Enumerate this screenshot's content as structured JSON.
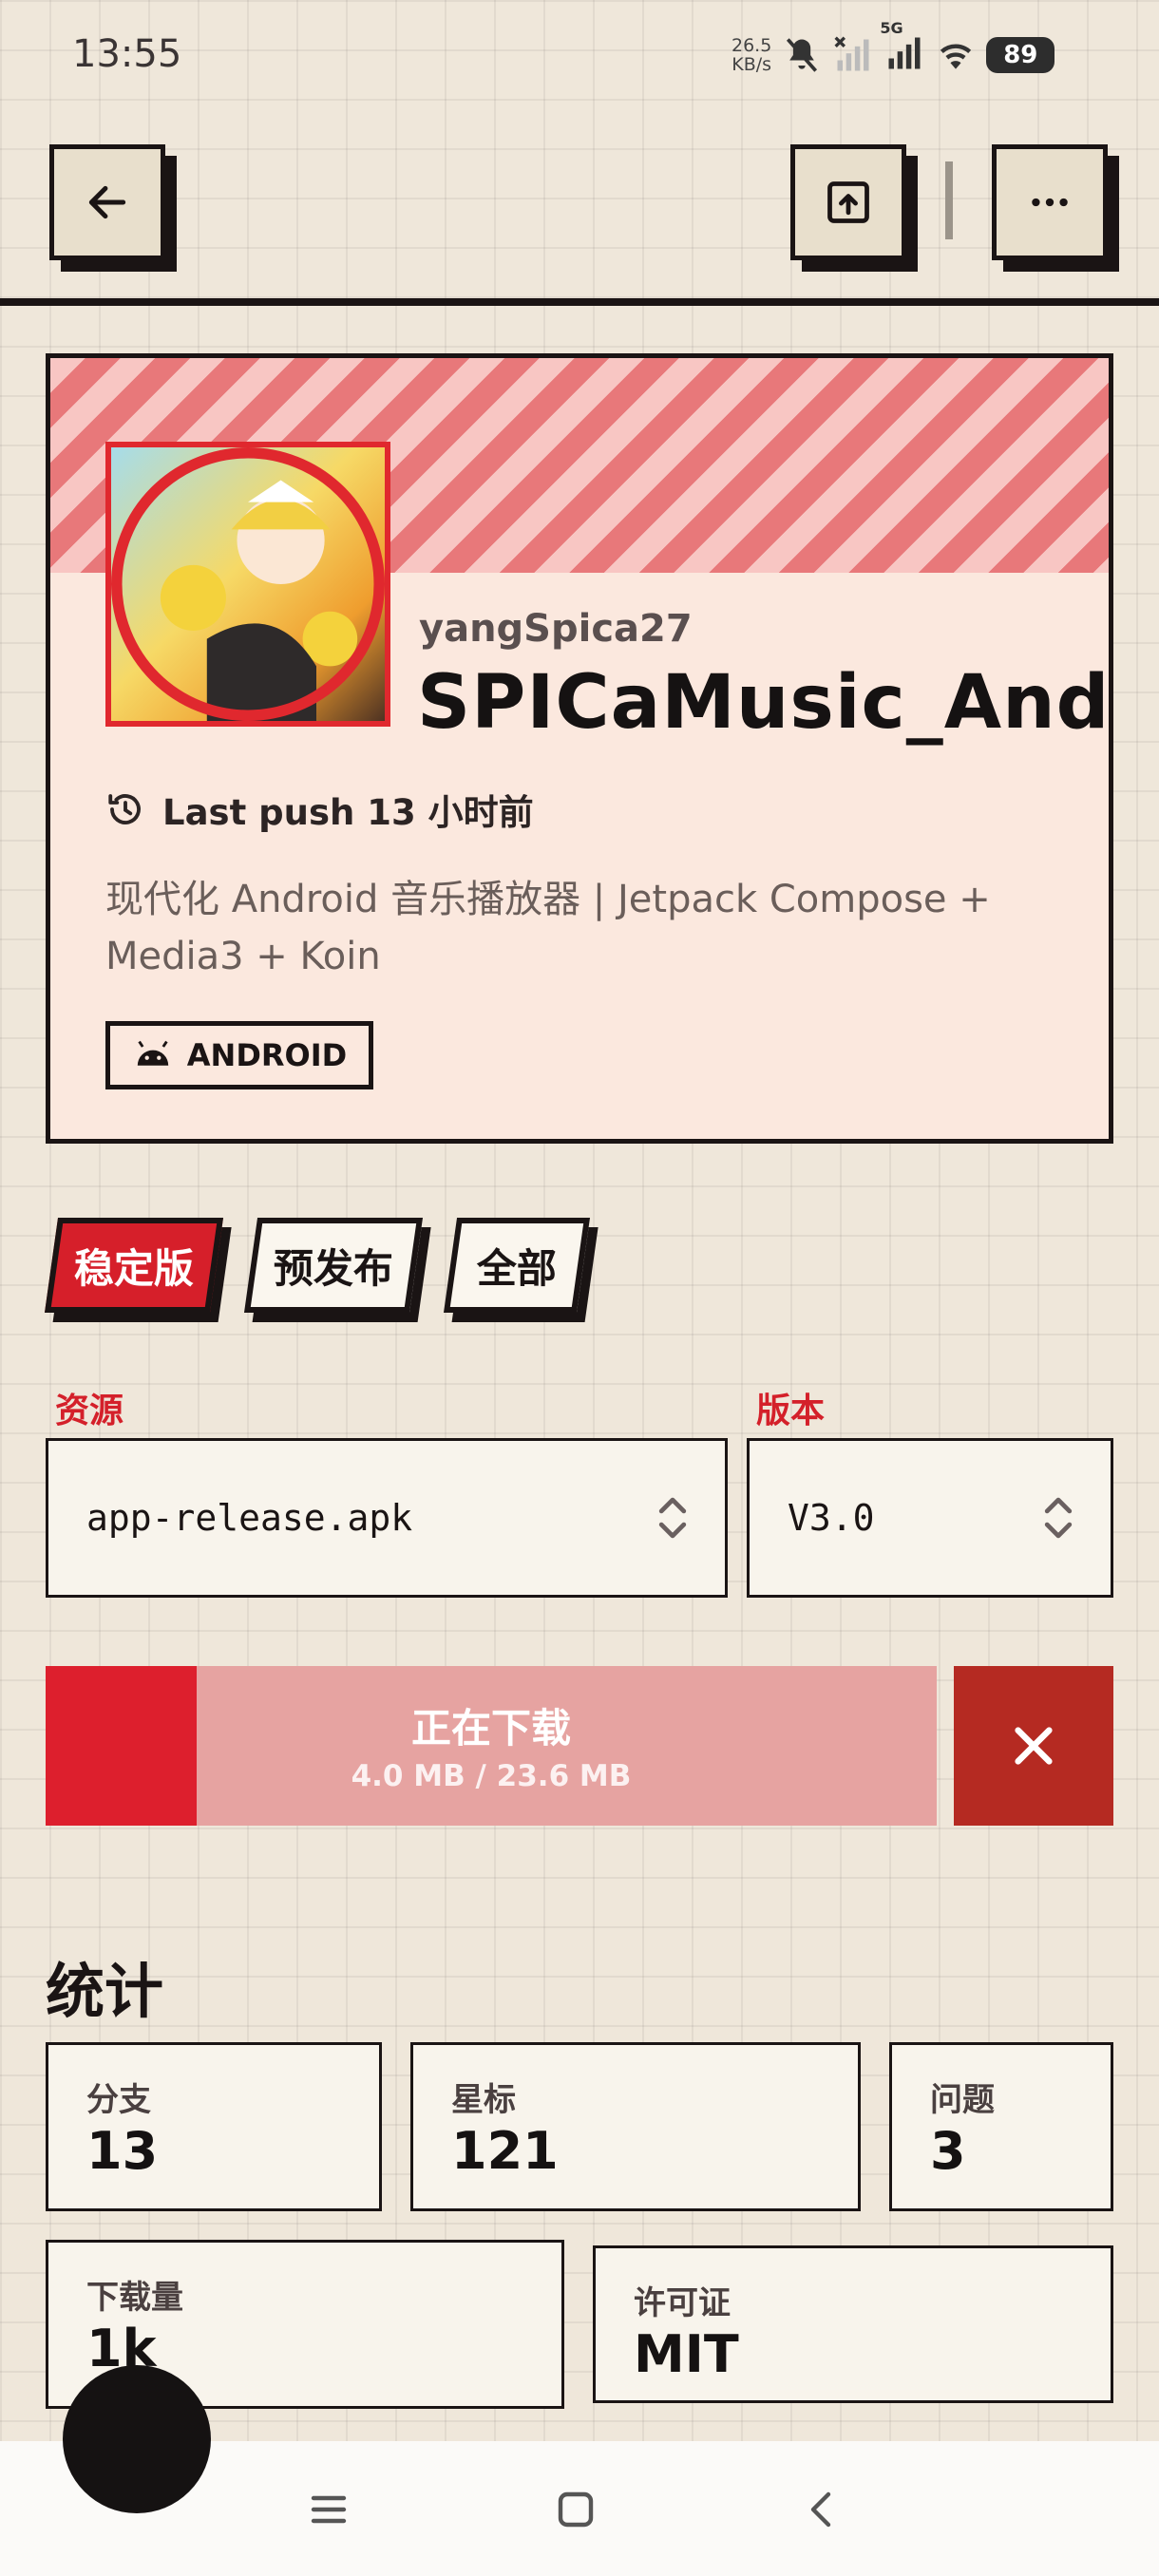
{
  "status_bar": {
    "time": "13:55",
    "net_speed_value": "26.5",
    "net_speed_unit": "KB/s",
    "network_type": "5G",
    "battery": "89"
  },
  "toolbar": {
    "back_icon": "arrow-left-icon",
    "share_icon": "open-external-icon",
    "more_icon": "more-horizontal-icon"
  },
  "repo": {
    "owner": "yangSpica27",
    "name": "SPICaMusic_Android",
    "last_push": "Last push 13 小时前",
    "description": "现代化 Android 音乐播放器 | Jetpack Compose + Media3 + Koin",
    "tag": "ANDROID"
  },
  "tabs": [
    {
      "label": "稳定版",
      "active": true
    },
    {
      "label": "预发布",
      "active": false
    },
    {
      "label": "全部",
      "active": false
    }
  ],
  "selectors": {
    "asset_label": "资源",
    "asset_value": "app-release.apk",
    "version_label": "版本",
    "version_value": "V3.0"
  },
  "download": {
    "title": "正在下载",
    "size_text": "4.0 MB / 23.6 MB",
    "progress": 0.17,
    "cancel_icon": "close-icon"
  },
  "stats": {
    "title": "统计",
    "branches_label": "分支",
    "branches_value": "13",
    "stars_label": "星标",
    "stars_value": "121",
    "issues_label": "问题",
    "issues_value": "3",
    "downloads_label": "下载量",
    "downloads_value": "1k",
    "license_label": "许可证",
    "license_value": "MIT"
  },
  "colors": {
    "accent_red": "#dd1f2d",
    "ink": "#1a1414",
    "paper": "#efe7da"
  }
}
